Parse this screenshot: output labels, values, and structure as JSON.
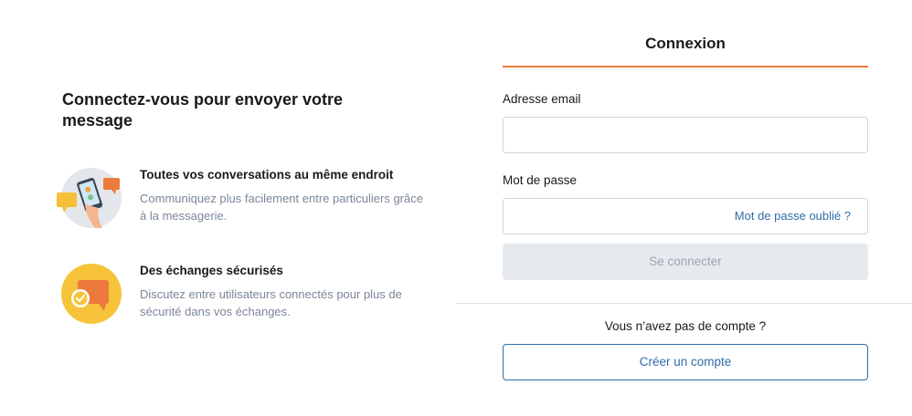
{
  "left": {
    "title": "Connectez-vous pour envoyer votre message",
    "features": [
      {
        "icon": "phone-chat-icon",
        "title": "Toutes vos conversations au même endroit",
        "description": "Communiquez plus facilement entre particuliers grâce à la messagerie."
      },
      {
        "icon": "secure-chat-icon",
        "title": "Des échanges sécurisés",
        "description": "Discutez entre utilisateurs connectés pour plus de sécurité dans vos échanges."
      }
    ]
  },
  "login": {
    "tab_title": "Connexion",
    "email_label": "Adresse email",
    "email_value": "",
    "password_label": "Mot de passe",
    "password_value": "",
    "forgot_password": "Mot de passe oublié ?",
    "submit_label": "Se connecter",
    "no_account_text": "Vous n’avez pas de compte ?",
    "create_account_label": "Créer un compte"
  },
  "colors": {
    "accent_orange": "#ec7a3c",
    "link_blue": "#2f6ea6",
    "disabled_button_bg": "#e6eaef",
    "muted_text": "#7a8796"
  }
}
